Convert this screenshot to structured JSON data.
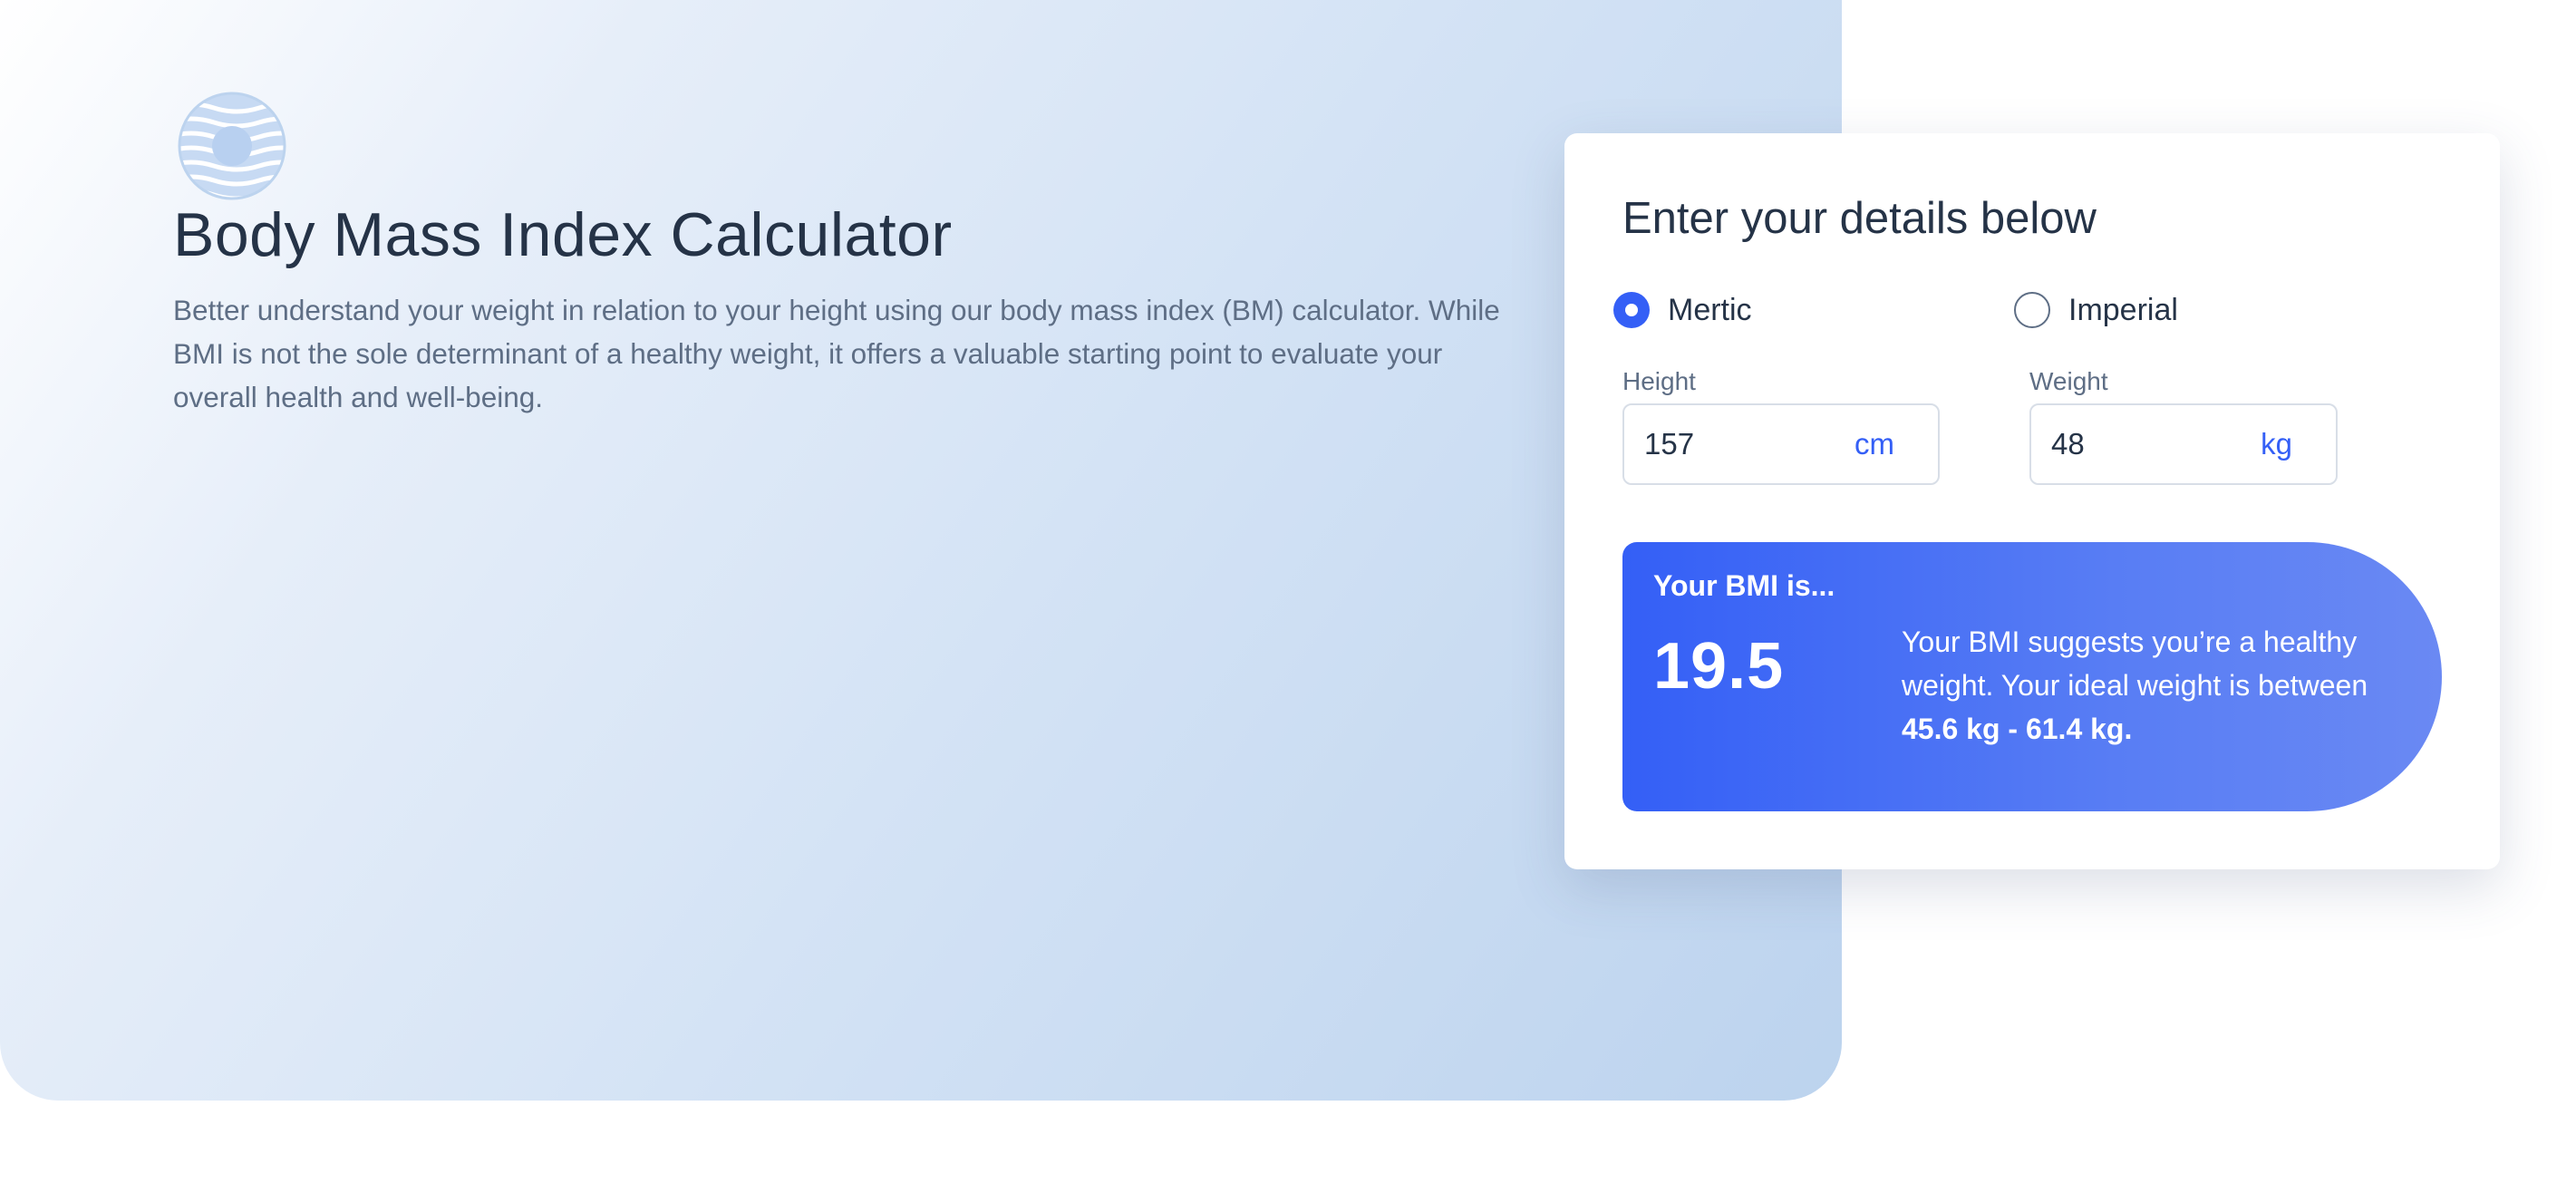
{
  "hero": {
    "title": "Body Mass Index Calculator",
    "description": "Better understand your weight in relation to your height using our body mass index (BM) calculator. While BMI is not the sole determinant of a healthy weight, it offers a valuable starting point to evaluate your overall health and well-being."
  },
  "form": {
    "heading": "Enter your details below",
    "units": [
      {
        "label": "Mertic",
        "selected": true
      },
      {
        "label": "Imperial",
        "selected": false
      }
    ],
    "height": {
      "label": "Height",
      "value": "157",
      "unit": "cm"
    },
    "weight": {
      "label": "Weight",
      "value": "48",
      "unit": "kg"
    }
  },
  "result": {
    "caption": "Your BMI is...",
    "value": "19.5",
    "message": "Your BMI suggests you’re a healthy weight. Your ideal weight is between",
    "ideal_range": "45.6 kg - 61.4 kg."
  },
  "colors": {
    "accent": "#345ff6",
    "heading": "#253347",
    "body_text": "#5e6e85"
  },
  "icons": {
    "logo": "striped-circle-logo-icon"
  }
}
